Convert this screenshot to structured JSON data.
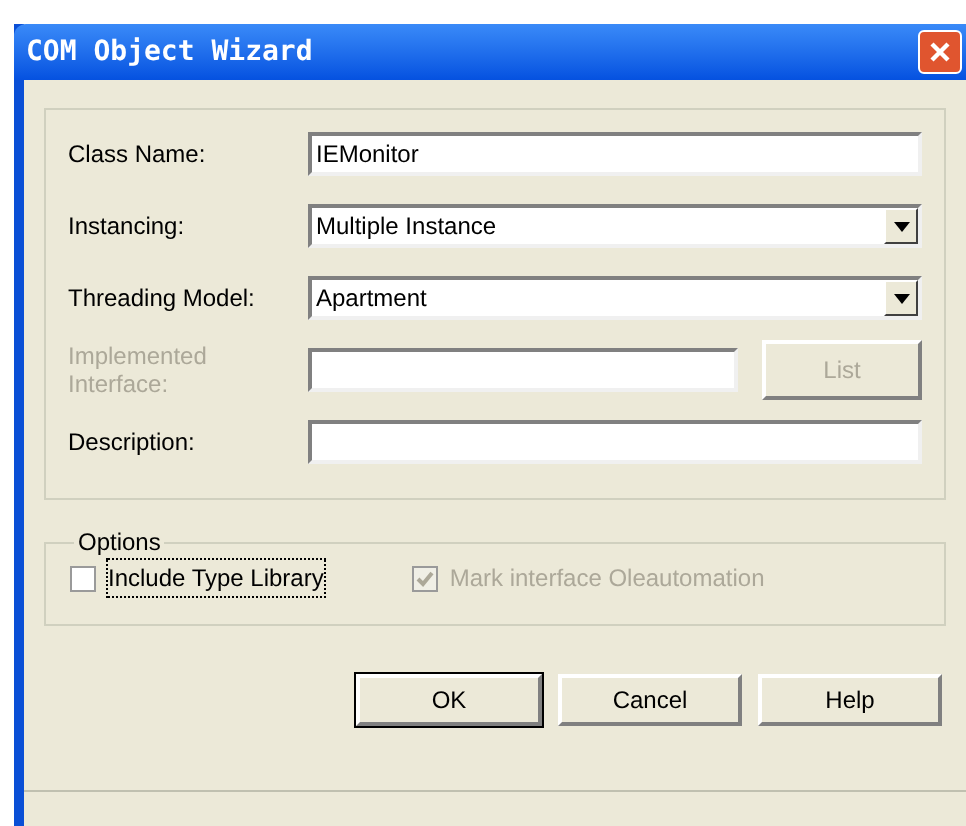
{
  "window": {
    "title": "COM Object Wizard"
  },
  "fields": [
    {
      "kind": "text",
      "label": "Class Name:",
      "value": "IEMonitor",
      "disabled": false
    },
    {
      "kind": "dropdown",
      "label": "Instancing:",
      "value": "Multiple Instance",
      "disabled": false
    },
    {
      "kind": "dropdown",
      "label": "Threading Model:",
      "value": "Apartment",
      "disabled": false
    },
    {
      "kind": "text_button",
      "label": "Implemented Interface:",
      "disabled": true,
      "button": "List"
    },
    {
      "kind": "text",
      "label": "Description:",
      "disabled": false
    }
  ],
  "options": {
    "title": "Options",
    "checkboxes": [
      {
        "label": "Include Type Library",
        "checked": false,
        "disabled": false,
        "focused": true
      },
      {
        "label": "Mark interface Oleautomation",
        "checked": true,
        "disabled": true,
        "focused": false
      }
    ]
  },
  "buttons": [
    {
      "label": "OK",
      "default": true
    },
    {
      "label": "Cancel",
      "default": false
    },
    {
      "label": "Help",
      "default": false
    }
  ]
}
